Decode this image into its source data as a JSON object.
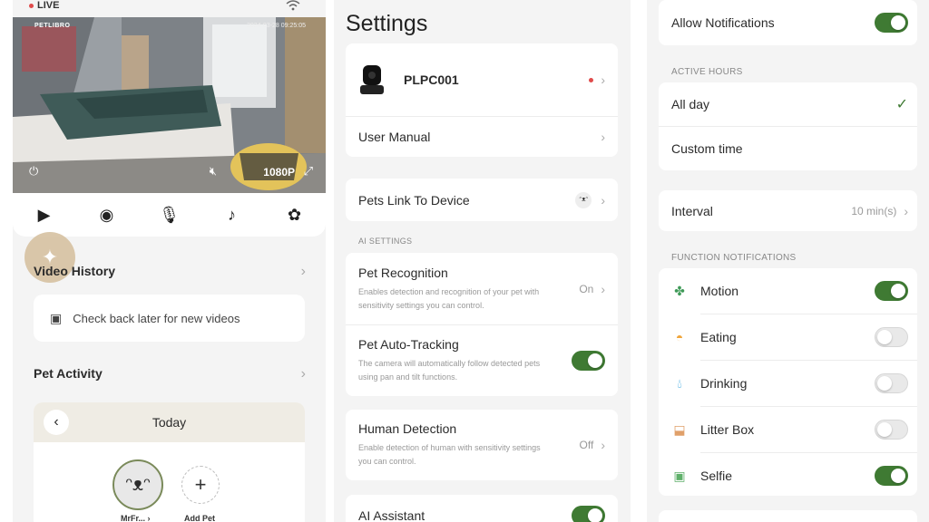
{
  "status": {
    "live_label": "LIVE"
  },
  "video": {
    "brand": "PETLIBRO",
    "timestamp": "2024-03-28 09:25:05",
    "resolution": "1080P"
  },
  "toolbar": [
    "video-camera-icon",
    "camera-icon",
    "microphone-icon",
    "music-note-icon",
    "palette-icon"
  ],
  "video_history": {
    "title": "Video History",
    "empty_text": "Check back later for new videos"
  },
  "pet_activity": {
    "title": "Pet Activity",
    "date_label": "Today",
    "pet_name": "MrFr...",
    "add_pet_label": "Add Pet"
  },
  "settings": {
    "title": "Settings",
    "device_name": "PLPC001",
    "user_manual": "User Manual",
    "pets_link": "Pets Link To Device",
    "ai_section": "AI SETTINGS",
    "pet_recognition": {
      "label": "Pet Recognition",
      "desc": "Enables detection and recognition of your pet with sensitivity settings you can control.",
      "value": "On"
    },
    "pet_tracking": {
      "label": "Pet Auto-Tracking",
      "desc": "The camera will automatically follow detected pets using pan and tilt functions.",
      "enabled": true
    },
    "human_detection": {
      "label": "Human Detection",
      "desc": "Enable detection of human with sensitivity settings you can control.",
      "value": "Off"
    },
    "ai_assistant": {
      "label": "AI Assistant",
      "enabled": true
    }
  },
  "notifications": {
    "allow_label": "Allow Notifications",
    "allow_enabled": true,
    "active_hours_section": "ACTIVE HOURS",
    "all_day": "All day",
    "custom_time": "Custom time",
    "interval_label": "Interval",
    "interval_value": "10 min(s)",
    "function_section": "FUNCTION NOTIFICATIONS",
    "functions": [
      {
        "label": "Motion",
        "icon": "paw-icon",
        "enabled": true,
        "color": "#3f9a58"
      },
      {
        "label": "Eating",
        "icon": "bowl-icon",
        "enabled": false,
        "color": "#f0a53a"
      },
      {
        "label": "Drinking",
        "icon": "water-drop-icon",
        "enabled": false,
        "color": "#3aa7e0"
      },
      {
        "label": "Litter Box",
        "icon": "litter-box-icon",
        "enabled": false,
        "color": "#e0a06a"
      },
      {
        "label": "Selfie",
        "icon": "selfie-icon",
        "enabled": true,
        "color": "#5fb06a"
      }
    ]
  },
  "colors": {
    "accent": "#3f7a33",
    "background": "#f4f4f4"
  }
}
